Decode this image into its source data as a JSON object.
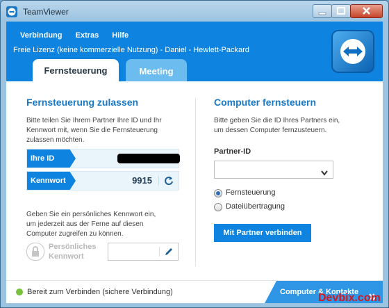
{
  "window": {
    "title": "TeamViewer"
  },
  "menu": {
    "items": [
      "Verbindung",
      "Extras",
      "Hilfe"
    ]
  },
  "license": "Freie Lizenz (keine kommerzielle Nutzung) - Daniel - Hewlett-Packard",
  "tabs": [
    {
      "label": "Fernsteuerung",
      "active": true
    },
    {
      "label": "Meeting",
      "active": false
    }
  ],
  "left": {
    "heading": "Fernsteuerung zulassen",
    "desc_lines": [
      "Bitte teilen Sie Ihrem Partner Ihre ID und Ihr",
      "Kennwort mit, wenn Sie die Fernsteuerung",
      "zulassen möchten."
    ],
    "id_label": "Ihre ID",
    "password_label": "Kennwort",
    "password_value": "9915",
    "personal_desc_lines": [
      "Geben Sie ein persönliches Kennwort ein,",
      "um jederzeit aus der Ferne auf diesen",
      "Computer zugreifen zu können."
    ],
    "personal_label_lines": [
      "Persönliches",
      "Kennwort"
    ]
  },
  "right": {
    "heading": "Computer fernsteuern",
    "desc_lines": [
      "Bitte geben Sie die ID Ihres Partners ein,",
      "um dessen Computer fernzusteuern."
    ],
    "partner_label": "Partner-ID",
    "options": [
      "Fernsteuerung",
      "Dateiübertragung"
    ],
    "connect_button": "Mit Partner verbinden"
  },
  "status": {
    "text": "Bereit zum Verbinden (sichere Verbindung)",
    "contacts_button": "Computer & Kontakte"
  },
  "watermark": "Devbix.com",
  "colors": {
    "accent": "#0e84e0",
    "heading": "#1a78c2",
    "status_ok": "#77c13e",
    "watermark": "#d4181f"
  }
}
